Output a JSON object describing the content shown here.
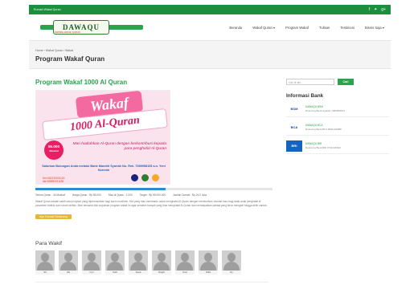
{
  "topbar": {
    "brand": "Rumah Wakaf Quran",
    "icons": [
      "facebook-icon",
      "twitter-icon",
      "googleplus-icon"
    ]
  },
  "logo": {
    "text": "DAWAQU",
    "subtext": "DAKWAH WAKAF QUR'AN"
  },
  "nav": [
    "Beranda",
    "Wakaf Quran ▾",
    "Program Wakaf",
    "Tulisan",
    "Testimoni",
    "Bisnis Saja ▾"
  ],
  "breadcrumb": "Home › Wakaf Quran › Wakaf",
  "page_title": "Program Wakaf Quran",
  "program": {
    "title": "Program Wakaf 1000 Al Quran",
    "banner": {
      "tag": "Wakaf",
      "headline": "1000 Al-Quran",
      "price": "55.000",
      "price_unit": "/Mushaf",
      "slogan": "Mari hadiahkan Al-Quran dengan berkontribusi kepada para penghafal Al-Quran",
      "account": "Salurkan Bulungan Anda melalui Bank Mandiri Syariah No. Rek. 7089958153 a.n. Yeni Nurmini",
      "phone1": "Dini 082120001120",
      "phone2": "Ida 085850011185"
    },
    "progress": 0.55,
    "stats": [
      "Terima Quran : 40 Mushaf",
      "Harga Quran : Rp.55.000",
      "Sisa di Quran : 1.000",
      "Target : Rp.55.000.000",
      "Jumlah Donasi : Rp.24.0 Juta"
    ],
    "description": "Wakaf Quran adalah salah satu program yang diperuntukkan bagi kaum muslimin. Kini yang mau membantu untuk menghafal Al-Quran dengan memberikan mushaf baru bagi anak-anak penghafal di pesantren tahfidz dan rumah tahfidz. Mari bersama kita wujudkan program wakaf ini agar semakin banyak yang bisa menghafal Al-Quran dan mendapatkan pahala yang terus mengalir hingga akhir zaman.",
    "donate_label": "Ayo Donasi Sekarang"
  },
  "para_wakif": {
    "title": "Para Wakif",
    "names": [
      "Sit",
      "Ida",
      "Cyn",
      "Sobi",
      "Susa",
      "Raghi",
      "Kusi",
      "Dilla",
      "Ny"
    ]
  },
  "sidebar": {
    "search_placeholder": "Cari di sini...",
    "search_button": "Cari",
    "info_title": "Informasi Bank",
    "banks": [
      {
        "logo": "BSM",
        "name": "DAWAQU BSM",
        "detail": "Rekening Bank Syariah 7089958153",
        "color": "#1b4f9c"
      },
      {
        "logo": "BCA",
        "name": "DAWAQU BCA",
        "detail": "Rekening Bank BCA 8691449988",
        "color": "#0d47a1"
      },
      {
        "logo": "BRI",
        "name": "DAWAQU BRI",
        "detail": "Rekening Bank BRI 0731016620",
        "color": "#1565c0"
      }
    ]
  }
}
